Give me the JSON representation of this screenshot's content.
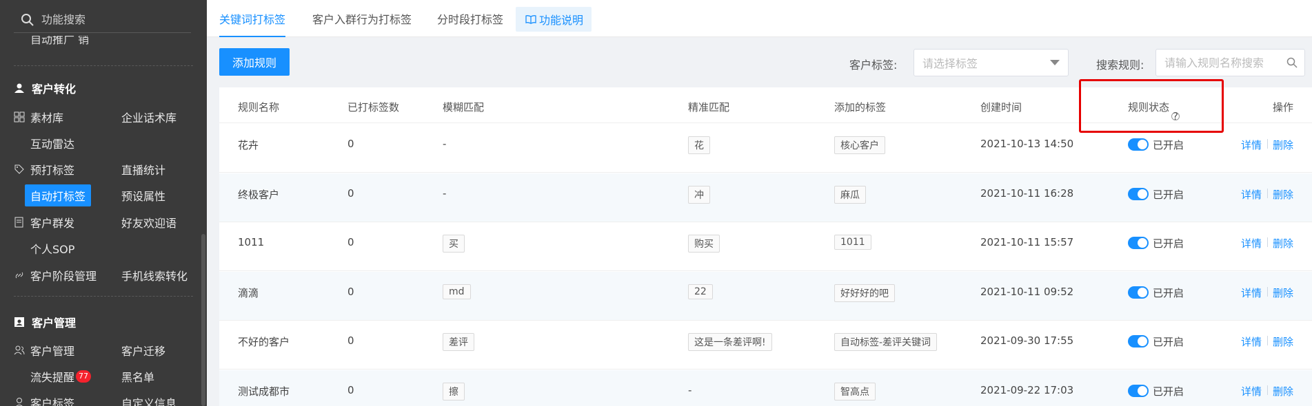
{
  "sidebar": {
    "search_placeholder": "功能搜索",
    "cut_item": "自动推广 销",
    "groups": [
      {
        "label": "客户转化"
      },
      {
        "label": "客户管理"
      }
    ],
    "items": {
      "materials": "素材库",
      "enterprise_scripts": "企业话术库",
      "interactive_radar": "互动雷达",
      "pre_tag": "预打标签",
      "live_stats": "直播统计",
      "auto_tag": "自动打标签",
      "preset_attrs": "预设属性",
      "mass_send": "客户群发",
      "welcome": "好友欢迎语",
      "personal_sop": "个人SOP",
      "stage_mgmt": "客户阶段管理",
      "phone_leads": "手机线索转化",
      "customer_mgmt": "客户管理",
      "customer_migrate": "客户迁移",
      "churn_alert": "流失提醒",
      "churn_badge": "77",
      "blacklist": "黑名单",
      "customer_tags": "客户标签",
      "custom_info": "自定义信息"
    }
  },
  "tabs": {
    "keyword": "关键词打标签",
    "join_group": "客户入群行为打标签",
    "time_slot": "分时段打标签",
    "help": "功能说明"
  },
  "toolbar": {
    "add_rule": "添加规则",
    "tag_label": "客户标签:",
    "tag_placeholder": "请选择标签",
    "search_label": "搜索规则:",
    "search_placeholder": "请输入规则名称搜索"
  },
  "table": {
    "headers": {
      "name": "规则名称",
      "tagged_count": "已打标签数",
      "fuzzy": "模糊匹配",
      "exact": "精准匹配",
      "added_tags": "添加的标签",
      "created": "创建时间",
      "status": "规则状态",
      "actions": "操作"
    },
    "rows": [
      {
        "name": "花卉",
        "count": "0",
        "fuzzy": "-",
        "fuzzy_tag": false,
        "exact": "花",
        "exact_tag": true,
        "tag": "核心客户",
        "created": "2021-10-13 14:50",
        "status": "已开启"
      },
      {
        "name": "终极客户",
        "count": "0",
        "fuzzy": "-",
        "fuzzy_tag": false,
        "exact": "冲",
        "exact_tag": true,
        "tag": "麻瓜",
        "created": "2021-10-11 16:28",
        "status": "已开启"
      },
      {
        "name": "1011",
        "count": "0",
        "fuzzy": "买",
        "fuzzy_tag": true,
        "exact": "购买",
        "exact_tag": true,
        "tag": "1011",
        "created": "2021-10-11 15:57",
        "status": "已开启"
      },
      {
        "name": "滴滴",
        "count": "0",
        "fuzzy": "md",
        "fuzzy_tag": true,
        "exact": "22",
        "exact_tag": true,
        "tag": "好好好的吧",
        "created": "2021-10-11 09:52",
        "status": "已开启"
      },
      {
        "name": "不好的客户",
        "count": "0",
        "fuzzy": "差评",
        "fuzzy_tag": true,
        "exact": "这是一条差评啊!",
        "exact_tag": true,
        "tag": "自动标签-差评关键词",
        "created": "2021-09-30 17:55",
        "status": "已开启"
      },
      {
        "name": "测试成都市",
        "count": "0",
        "fuzzy": "擦",
        "fuzzy_tag": true,
        "exact": "-",
        "exact_tag": false,
        "tag": "智高点",
        "created": "2021-09-22 17:03",
        "status": "已开启"
      }
    ],
    "detail_label": "详情",
    "delete_label": "删除"
  },
  "colors": {
    "accent": "#1890ff",
    "sidebar_bg": "#3a3a3a",
    "highlight": "#e60000"
  }
}
